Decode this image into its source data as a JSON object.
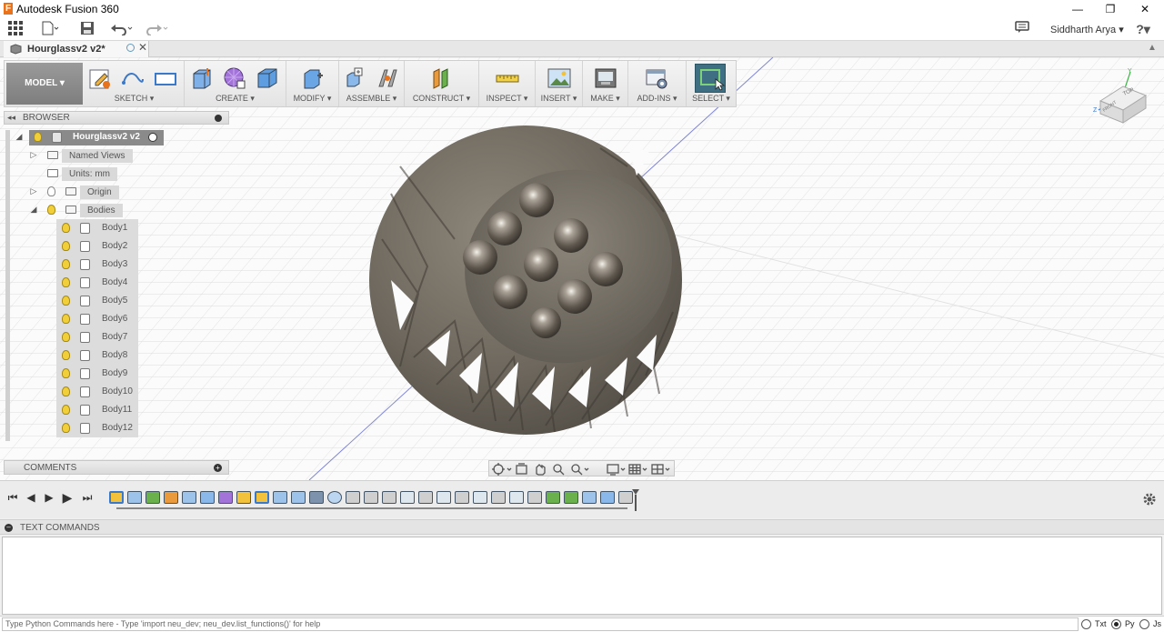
{
  "app": {
    "title": "Autodesk Fusion 360"
  },
  "window": {
    "minimize": "—",
    "restore": "❐",
    "close": "✕"
  },
  "qat": {
    "user": "Siddharth Arya ▾",
    "help": "?▾"
  },
  "document": {
    "tab_title": "Hourglassv2 v2*"
  },
  "workspace": {
    "label": "MODEL ▾"
  },
  "toolbar": {
    "groups": [
      {
        "label": "SKETCH ▾"
      },
      {
        "label": "CREATE ▾"
      },
      {
        "label": "MODIFY ▾"
      },
      {
        "label": "ASSEMBLE ▾"
      },
      {
        "label": "CONSTRUCT ▾"
      },
      {
        "label": "INSPECT ▾"
      },
      {
        "label": "INSERT ▾"
      },
      {
        "label": "MAKE ▾"
      },
      {
        "label": "ADD-INS ▾"
      },
      {
        "label": "SELECT ▾"
      }
    ]
  },
  "browser": {
    "title": "BROWSER",
    "root": "Hourglassv2 v2",
    "named_views": "Named Views",
    "units": "Units: mm",
    "origin": "Origin",
    "bodies_folder": "Bodies",
    "bodies": [
      "Body1",
      "Body2",
      "Body3",
      "Body4",
      "Body5",
      "Body6",
      "Body7",
      "Body8",
      "Body9",
      "Body10",
      "Body11",
      "Body12"
    ]
  },
  "comments": {
    "title": "COMMENTS"
  },
  "viewcube": {
    "top": "TOP",
    "front": "FRONT"
  },
  "text_commands": {
    "title": "TEXT COMMANDS",
    "placeholder": "Type Python Commands here - Type 'import neu_dev; neu_dev.list_functions()' for help",
    "modes": [
      "Txt",
      "Py",
      "Js"
    ],
    "selected_mode": "Py"
  },
  "colors": {
    "accent": "#4a7f9a",
    "select_active": "#3f6f82",
    "bulb": "#f0cf3a"
  }
}
